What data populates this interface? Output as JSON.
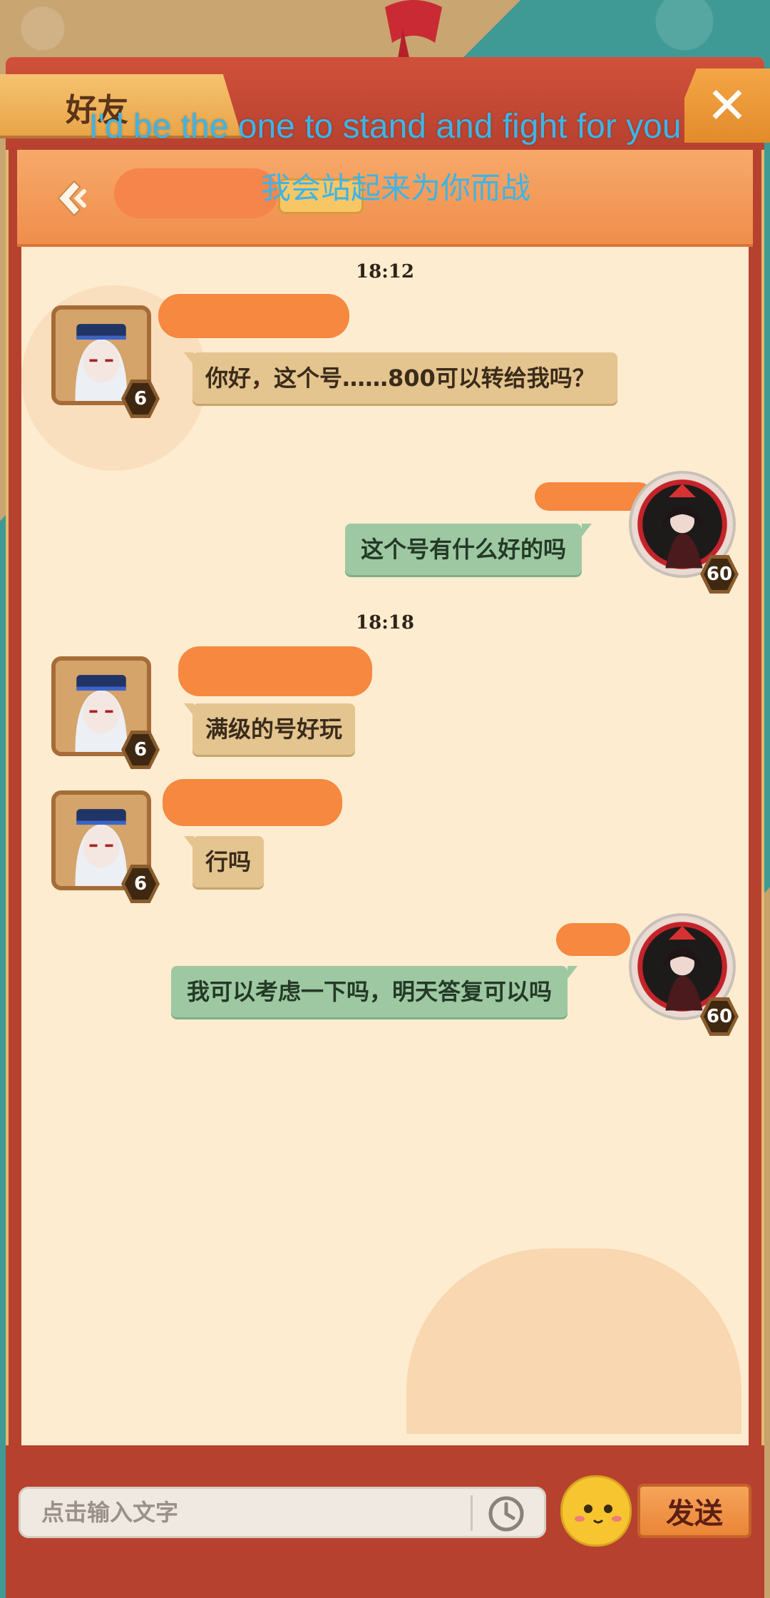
{
  "window": {
    "tab_label": "好友"
  },
  "subtitles": {
    "english": "I'd be the one to stand and fight for you",
    "chinese": "我会站起来为你而战"
  },
  "messages": [
    {
      "type": "timestamp",
      "text": "18:12"
    },
    {
      "type": "other",
      "text": "你好，这个号……800可以转给我吗？",
      "level": "6"
    },
    {
      "type": "self",
      "text": "这个号有什么好的吗",
      "level": "60"
    },
    {
      "type": "timestamp",
      "text": "18:18"
    },
    {
      "type": "other",
      "text": "满级的号好玩",
      "level": "6"
    },
    {
      "type": "other",
      "text": "行吗",
      "level": "6"
    },
    {
      "type": "self",
      "text": "我可以考虑一下吗，明天答复可以吗",
      "level": "60"
    }
  ],
  "input": {
    "placeholder": "点击输入文字",
    "value": ""
  },
  "send_label": "发送",
  "colors": {
    "frame": "#b7412f",
    "header": "#f08e4c",
    "chat_bg": "#fdecd0",
    "bubble_other": "#e4c48f",
    "bubble_self": "#9ec8a2",
    "subtitle": "#3eb4e6"
  }
}
